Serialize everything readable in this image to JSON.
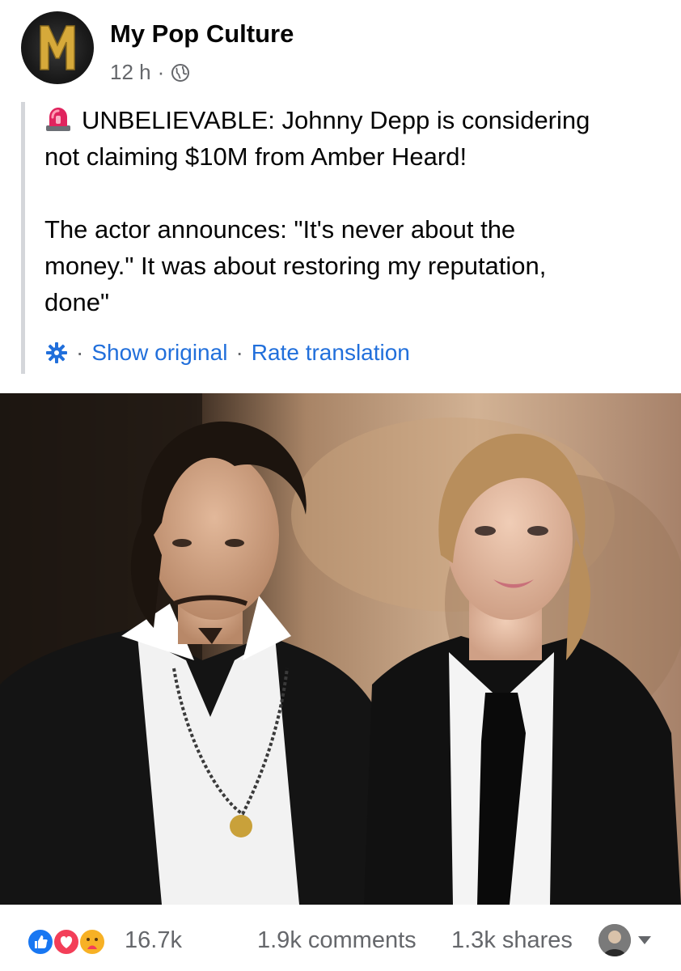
{
  "post": {
    "page_name": "My Pop Culture",
    "time": "12 h",
    "separator": "·",
    "headline": "UNBELIEVABLE: Johnny Depp is considering not claiming $10M from Amber Heard!",
    "quote_line1": "The actor announces: \"It's never about the",
    "quote_line2": "money.\" It was about restoring my reputation,",
    "quote_line3": "done\"",
    "headline_line1": "UNBELIEVABLE: Johnny Depp is considering",
    "headline_line2": "not claiming $10M from Amber Heard!"
  },
  "translation": {
    "separator": "·",
    "show_original": "Show original",
    "rate_translation": "Rate translation"
  },
  "footer": {
    "reaction_count": "16.7k",
    "comments": "1.9k comments",
    "shares": "1.3k shares"
  },
  "icons": {
    "avatar_logo": "M",
    "avatar_icon": "page-avatar",
    "globe": "globe-icon",
    "siren": "siren-icon",
    "gear": "gear-icon",
    "like": "like-reaction-icon",
    "love": "love-reaction-icon",
    "care": "care-reaction-icon",
    "caret": "caret-down-icon"
  },
  "colors": {
    "link": "#216fdb",
    "secondary_text": "#65676b",
    "like_blue": "#1877f2",
    "love_red": "#f33e58",
    "care_yellow": "#f7b125"
  }
}
